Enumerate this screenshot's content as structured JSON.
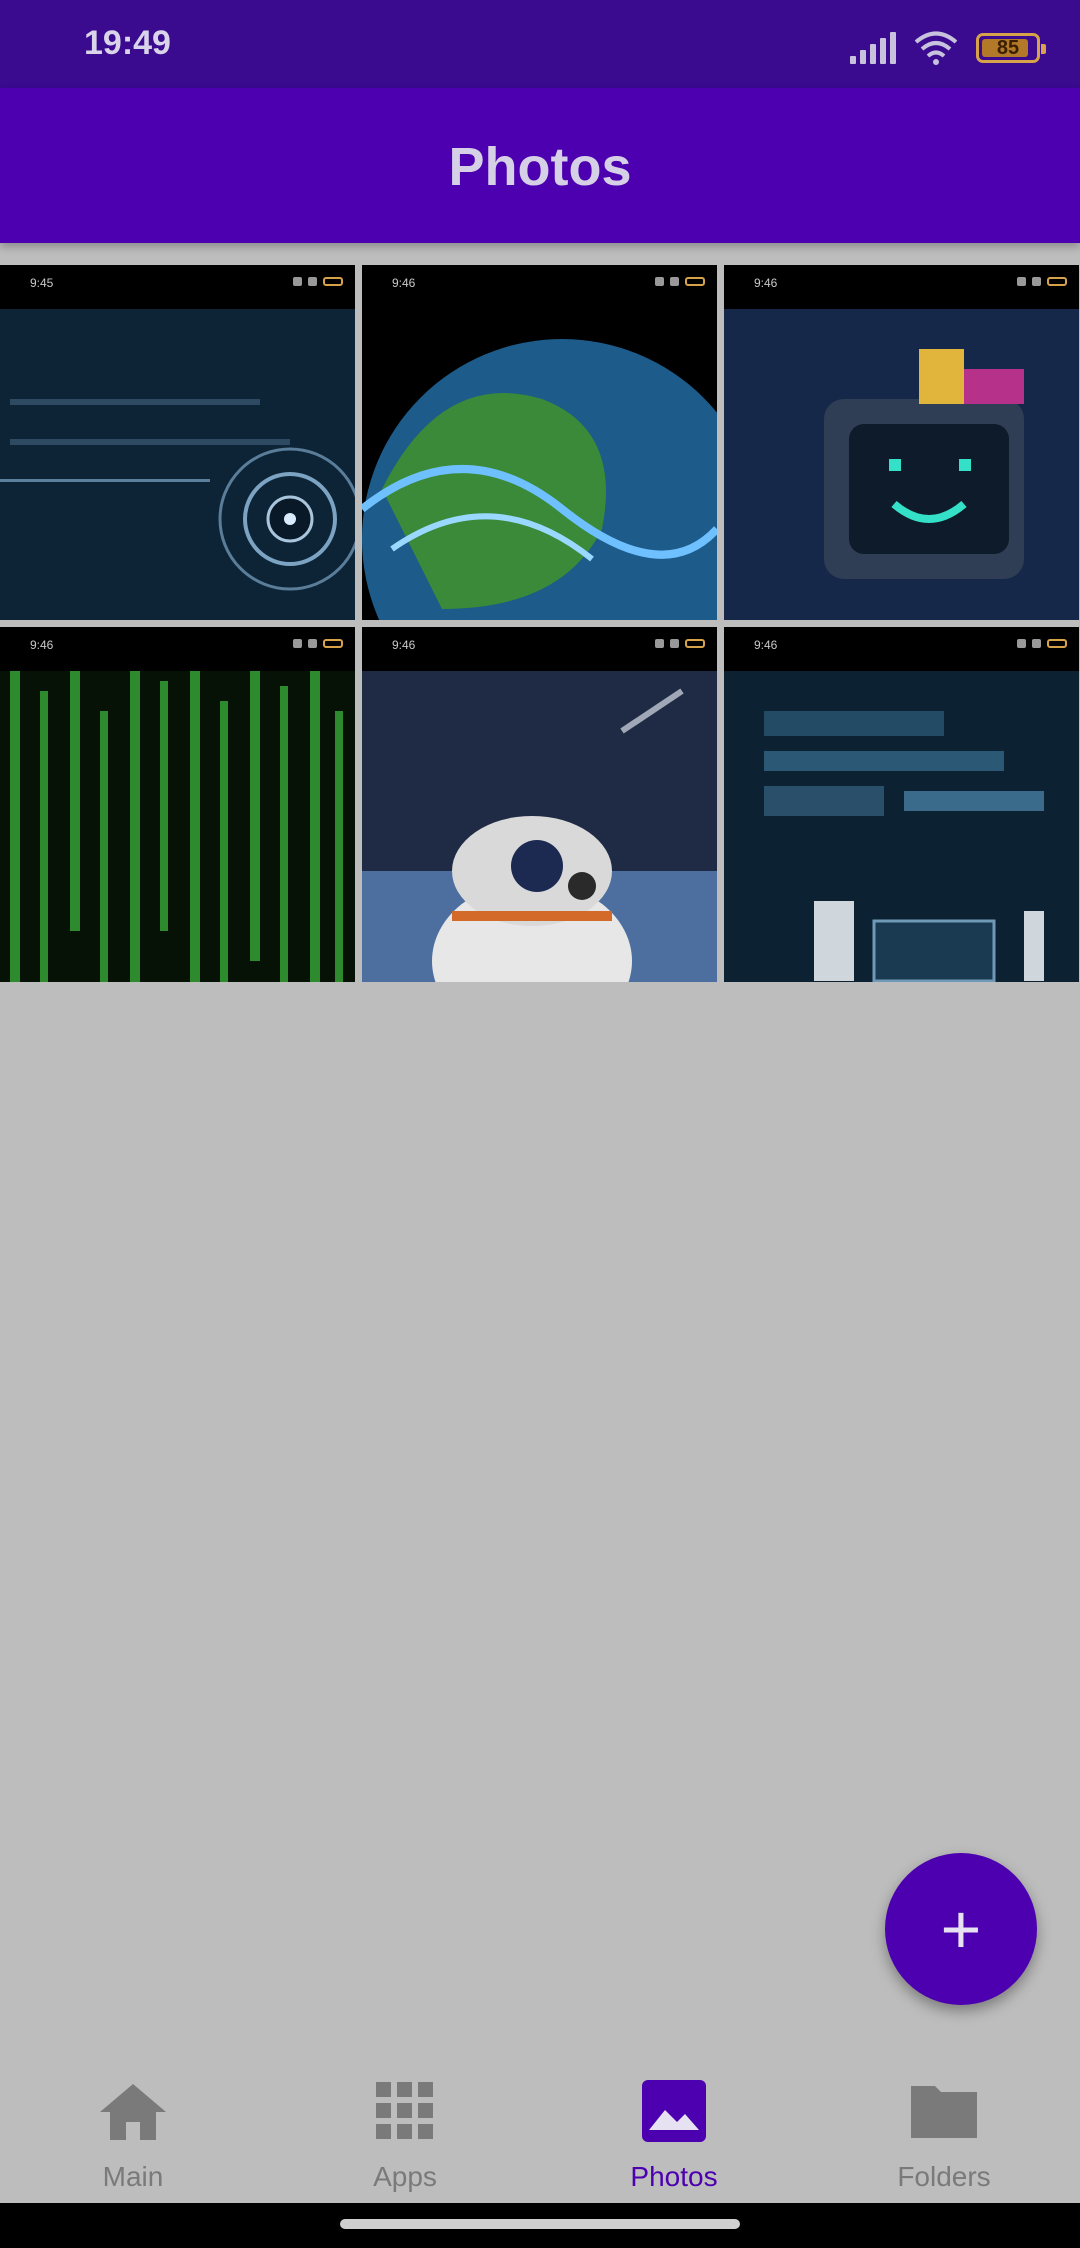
{
  "status_bar": {
    "time": "19:49",
    "battery": "85"
  },
  "app_bar": {
    "title": "Photos"
  },
  "photos": [
    {
      "time": "9:45",
      "subject": "digital circuit eye wallpaper"
    },
    {
      "time": "9:46",
      "subject": "blue earth globe wallpaper"
    },
    {
      "time": "9:46",
      "subject": "tv robot smiley wallpaper"
    },
    {
      "time": "9:46",
      "subject": "green matrix code wallpaper"
    },
    {
      "time": "9:46",
      "subject": "bb-8 droid space wallpaper"
    },
    {
      "time": "9:46",
      "subject": "blue motherboard wallpaper"
    }
  ],
  "fab": {
    "icon": "plus-icon",
    "symbol": "+"
  },
  "bottom_nav": {
    "items": [
      {
        "label": "Main",
        "icon": "home-icon"
      },
      {
        "label": "Apps",
        "icon": "apps-grid-icon"
      },
      {
        "label": "Photos",
        "icon": "photo-icon",
        "active": true
      },
      {
        "label": "Folders",
        "icon": "folder-icon"
      }
    ]
  },
  "colors": {
    "primary": "#4c00b0",
    "status_bar": "#3a0a8f",
    "background": "#bdbdbd"
  }
}
